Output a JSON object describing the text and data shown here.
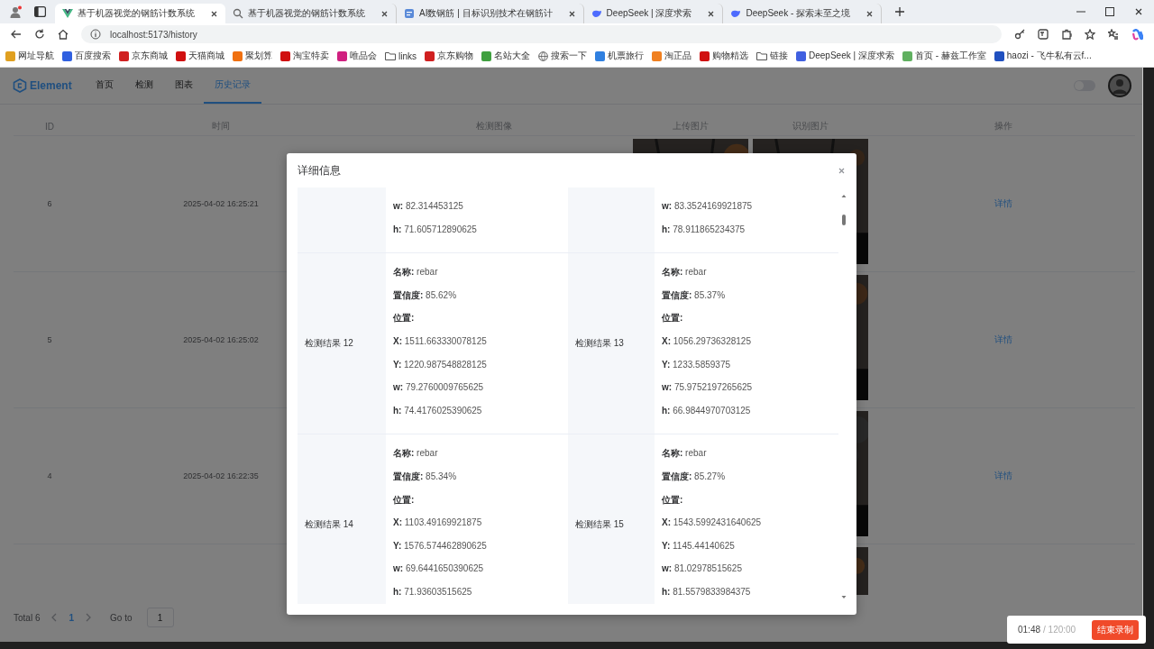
{
  "browser": {
    "tabs": [
      {
        "title": "基于机器视觉的钢筋计数系统",
        "kind": "vue",
        "selected": true
      },
      {
        "title": "基于机器视觉的钢筋计数系统",
        "kind": "search",
        "selected": false
      },
      {
        "title": "AI数钢筋 | 目标识别技术在钢筋计",
        "kind": "page",
        "selected": false
      },
      {
        "title": "DeepSeek | 深度求索",
        "kind": "whale",
        "selected": false
      },
      {
        "title": "DeepSeek - 探索未至之境",
        "kind": "whale",
        "selected": false
      }
    ],
    "address": "localhost:5173/history",
    "bookmarks": [
      {
        "label": "网址导航",
        "kind": "site",
        "color": "#e0a020"
      },
      {
        "label": "百度搜索",
        "kind": "site",
        "color": "#3060e0"
      },
      {
        "label": "京东商城",
        "kind": "site",
        "color": "#d02020"
      },
      {
        "label": "天猫商城",
        "kind": "site",
        "color": "#d01010"
      },
      {
        "label": "聚划算",
        "kind": "site",
        "color": "#f07010"
      },
      {
        "label": "淘宝特卖",
        "kind": "site",
        "color": "#d01010"
      },
      {
        "label": "唯品会",
        "kind": "site",
        "color": "#d02080"
      },
      {
        "label": "links",
        "kind": "folder"
      },
      {
        "label": "京东购物",
        "kind": "site",
        "color": "#d02020"
      },
      {
        "label": "名站大全",
        "kind": "site",
        "color": "#40a040"
      },
      {
        "label": "搜索一下",
        "kind": "globe"
      },
      {
        "label": "机票旅行",
        "kind": "site",
        "color": "#3080e0"
      },
      {
        "label": "淘正品",
        "kind": "site",
        "color": "#f08020"
      },
      {
        "label": "购物精选",
        "kind": "site",
        "color": "#d01010"
      },
      {
        "label": "链接",
        "kind": "folder"
      },
      {
        "label": "DeepSeek | 深度求索",
        "kind": "site",
        "color": "#4060e0"
      },
      {
        "label": "首页 - 赫兹工作室",
        "kind": "site",
        "color": "#60b060"
      },
      {
        "label": "haozi - 飞牛私有云f...",
        "kind": "site",
        "color": "#2050c0"
      }
    ]
  },
  "app": {
    "logo": "Element",
    "nav": [
      {
        "label": "首页",
        "selected": false
      },
      {
        "label": "检测",
        "selected": false
      },
      {
        "label": "图表",
        "selected": false
      },
      {
        "label": "历史记录",
        "selected": true
      }
    ],
    "switch": {
      "on": false
    }
  },
  "table": {
    "columns": [
      "ID",
      "时间",
      "检测图像",
      "上传图片",
      "识别图片",
      "操作"
    ],
    "rows": [
      {
        "kind": "full",
        "id": "6",
        "time": "2025-04-02 16:25:21",
        "action": "详情"
      },
      {
        "kind": "full",
        "id": "5",
        "time": "2025-04-02 16:25:02",
        "action": "详情"
      },
      {
        "kind": "full",
        "id": "4",
        "time": "2025-04-02 16:22:35",
        "action": "详情"
      },
      {
        "kind": "partial"
      }
    ]
  },
  "pagination": {
    "total": "Total 6",
    "pages": [
      {
        "label": "1",
        "selected": true
      }
    ],
    "goto_label": "Go to",
    "goto_value": "1"
  },
  "dialog": {
    "title": "详细信息",
    "rows": [
      {
        "cells": [
          {
            "lines": [
              {
                "key": "w:",
                "value": "82.314453125"
              },
              {
                "key": "h:",
                "value": "71.605712890625"
              }
            ]
          },
          {
            "lines": [
              {
                "key": "w:",
                "value": "83.3524169921875"
              },
              {
                "key": "h:",
                "value": "78.911865234375"
              }
            ]
          }
        ]
      },
      {
        "cells": [
          {
            "label": "检测结果 12",
            "lines": [
              {
                "key": "名称:",
                "value": "rebar"
              },
              {
                "key": "置信度:",
                "value": "85.62%"
              },
              {
                "key": "位置:"
              },
              {
                "key": "X:",
                "value": "1511.663330078125"
              },
              {
                "key": "Y:",
                "value": "1220.987548828125"
              },
              {
                "key": "w:",
                "value": "79.2760009765625"
              },
              {
                "key": "h:",
                "value": "74.4176025390625"
              }
            ]
          },
          {
            "label": "检测结果 13",
            "lines": [
              {
                "key": "名称:",
                "value": "rebar"
              },
              {
                "key": "置信度:",
                "value": "85.37%"
              },
              {
                "key": "位置:"
              },
              {
                "key": "X:",
                "value": "1056.29736328125"
              },
              {
                "key": "Y:",
                "value": "1233.5859375"
              },
              {
                "key": "w:",
                "value": "75.9752197265625"
              },
              {
                "key": "h:",
                "value": "66.9844970703125"
              }
            ]
          }
        ]
      },
      {
        "cells": [
          {
            "label": "检测结果 14",
            "lines": [
              {
                "key": "名称:",
                "value": "rebar"
              },
              {
                "key": "置信度:",
                "value": "85.34%"
              },
              {
                "key": "位置:"
              },
              {
                "key": "X:",
                "value": "1103.49169921875"
              },
              {
                "key": "Y:",
                "value": "1576.574462890625"
              },
              {
                "key": "w:",
                "value": "69.6441650390625"
              },
              {
                "key": "h:",
                "value": "71.93603515625"
              }
            ]
          },
          {
            "label": "检测结果 15",
            "lines": [
              {
                "key": "名称:",
                "value": "rebar"
              },
              {
                "key": "置信度:",
                "value": "85.27%"
              },
              {
                "key": "位置:"
              },
              {
                "key": "X:",
                "value": "1543.5992431640625"
              },
              {
                "key": "Y:",
                "value": "1145.44140625"
              },
              {
                "key": "w:",
                "value": "81.02978515625"
              },
              {
                "key": "h:",
                "value": "81.5579833984375"
              }
            ]
          }
        ]
      }
    ]
  },
  "recorder": {
    "elapsed": "01:48",
    "limit": "/ 120:00",
    "stop_button": "结束录制"
  }
}
